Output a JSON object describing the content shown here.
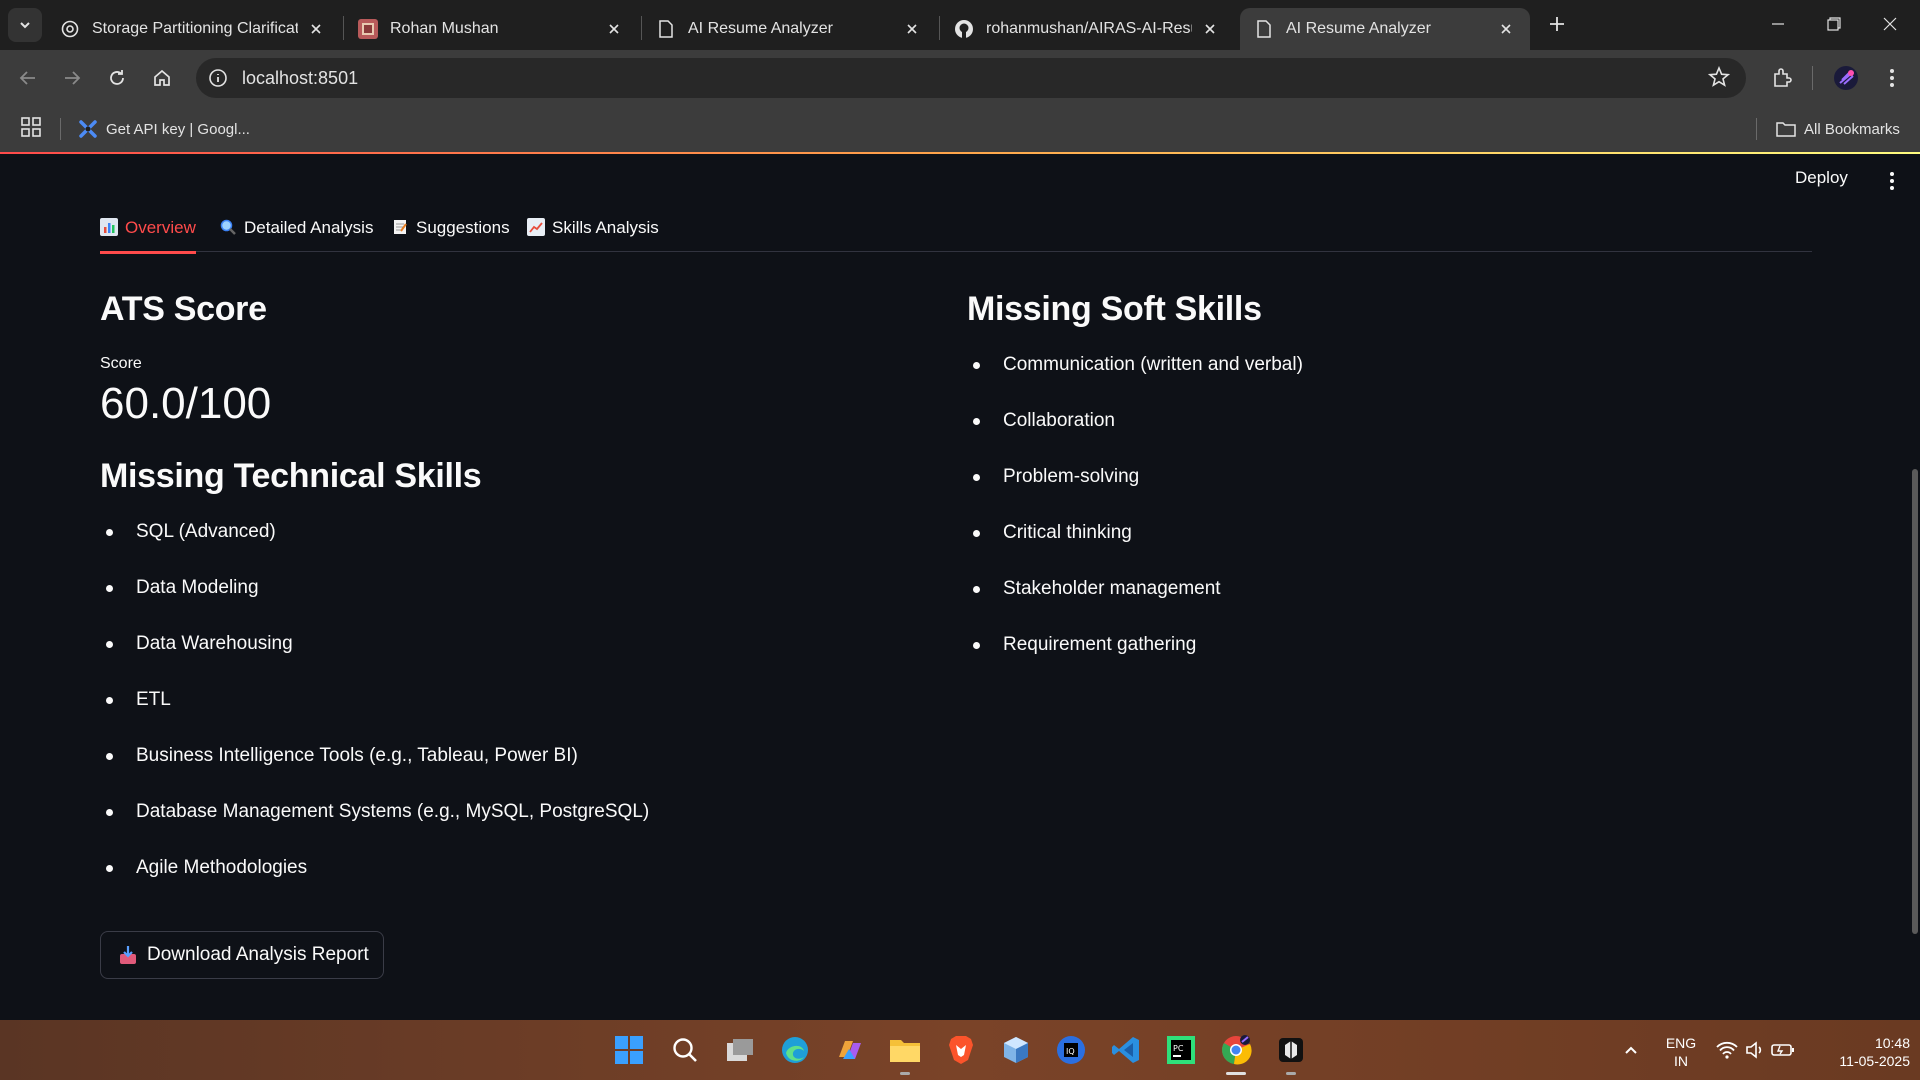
{
  "browser": {
    "tabs": [
      {
        "title": "Storage Partitioning Clarificatio",
        "icon": "openai-icon",
        "active": false
      },
      {
        "title": "Rohan Mushan",
        "icon": "profile-favicon",
        "active": false
      },
      {
        "title": "AI Resume Analyzer",
        "icon": "page-icon",
        "active": false
      },
      {
        "title": "rohanmushan/AIRAS-AI-Resum",
        "icon": "github-icon",
        "active": false
      },
      {
        "title": "AI Resume Analyzer",
        "icon": "page-icon",
        "active": true
      }
    ],
    "url": "localhost:8501",
    "bookmark": "Get API key | Googl...",
    "all_bookmarks": "All Bookmarks"
  },
  "app": {
    "deploy_label": "Deploy",
    "tabs": [
      {
        "label": "Overview",
        "emoji": "bar-chart-icon"
      },
      {
        "label": "Detailed Analysis",
        "emoji": "magnifier-icon"
      },
      {
        "label": "Suggestions",
        "emoji": "memo-icon"
      },
      {
        "label": "Skills Analysis",
        "emoji": "chart-increasing-icon"
      }
    ],
    "ats": {
      "heading": "ATS Score",
      "metric_label": "Score",
      "metric_value": "60.0/100"
    },
    "technical": {
      "heading": "Missing Technical Skills",
      "items": [
        "SQL (Advanced)",
        "Data Modeling",
        "Data Warehousing",
        "ETL",
        "Business Intelligence Tools (e.g., Tableau, Power BI)",
        "Database Management Systems (e.g., MySQL, PostgreSQL)",
        "Agile Methodologies"
      ]
    },
    "soft": {
      "heading": "Missing Soft Skills",
      "items": [
        "Communication (written and verbal)",
        "Collaboration",
        "Problem-solving",
        "Critical thinking",
        "Stakeholder management",
        "Requirement gathering"
      ]
    },
    "download_label": "Download Analysis Report",
    "accent_color": "#ff4b4b"
  },
  "taskbar": {
    "lang_top": "ENG",
    "lang_bottom": "IN",
    "time": "10:48",
    "date": "11-05-2025"
  }
}
